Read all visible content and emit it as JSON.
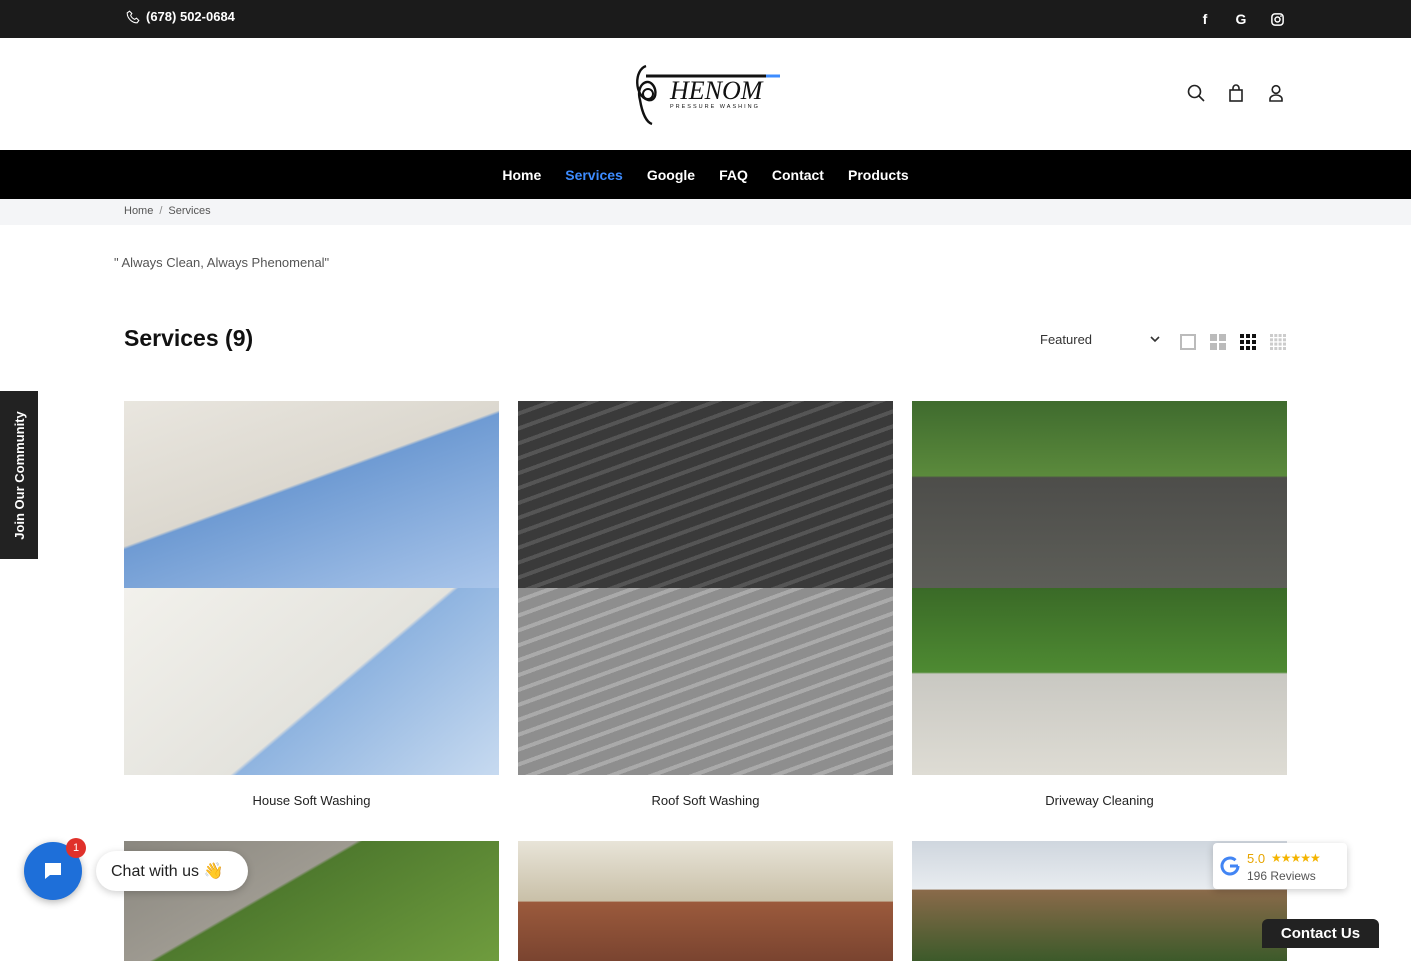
{
  "topbar": {
    "phone": "(678) 502-0684",
    "social": [
      "facebook-icon",
      "google-icon",
      "instagram-icon"
    ]
  },
  "header": {
    "logo_text": "HENOM",
    "logo_sub": "PRESSURE WASHING"
  },
  "nav": {
    "items": [
      {
        "label": "Home"
      },
      {
        "label": "Services"
      },
      {
        "label": "Google"
      },
      {
        "label": "FAQ"
      },
      {
        "label": "Contact"
      },
      {
        "label": "Products"
      }
    ],
    "active_index": 1,
    "active_color": "#3d8cff"
  },
  "breadcrumb": {
    "home": "Home",
    "sep": "/",
    "current": "Services"
  },
  "tagline": "\" Always Clean, Always Phenomenal\"",
  "page_title": "Services (9)",
  "sort": {
    "selected": "Featured"
  },
  "products": [
    {
      "name": "House Soft Washing"
    },
    {
      "name": "Roof Soft Washing"
    },
    {
      "name": "Driveway Cleaning"
    }
  ],
  "side_tab": "Join Our Community",
  "chat": {
    "badge": "1",
    "bubble": "Chat with us 👋"
  },
  "google_review": {
    "score": "5.0",
    "stars": "★★★★★",
    "count": "196 Reviews"
  },
  "contact_us": "Contact Us",
  "colors": {
    "topbar": "#1b1b1b",
    "nav": "#000000",
    "chat": "#1e6fd9",
    "badge": "#e0312b"
  }
}
